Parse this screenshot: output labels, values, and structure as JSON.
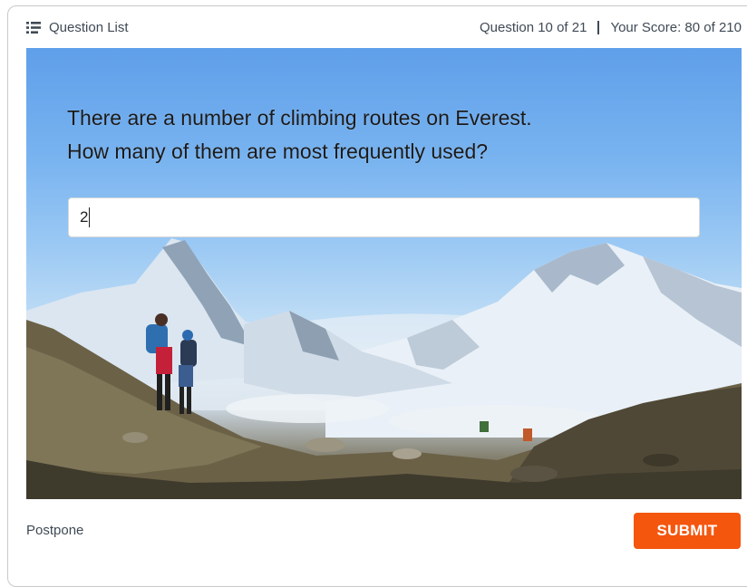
{
  "header": {
    "question_list_label": "Question List",
    "question_counter": "Question 10 of 21",
    "score_text": "Your Score: 80 of 210"
  },
  "question": {
    "line1": "There are a number of climbing routes on Everest.",
    "line2": "How many of them are most frequently used?"
  },
  "answer": {
    "value": "2"
  },
  "footer": {
    "postpone_label": "Postpone",
    "submit_label": "SUBMIT"
  },
  "colors": {
    "accent": "#f4560e",
    "text": "#3f4a55"
  },
  "icons": {
    "question_list": "list-icon"
  }
}
